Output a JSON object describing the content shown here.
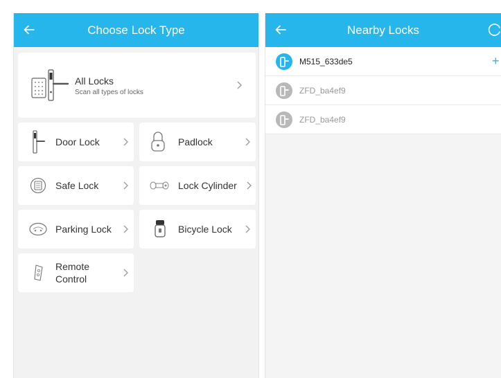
{
  "choose_lock_type": {
    "title": "Choose Lock Type",
    "all_locks": {
      "label": "All Locks",
      "subtitle": "Scan all types of locks"
    },
    "types": [
      {
        "label": "Door Lock",
        "icon": "door-lock-icon"
      },
      {
        "label": "Padlock",
        "icon": "padlock-icon"
      },
      {
        "label": "Safe Lock",
        "icon": "safe-lock-icon"
      },
      {
        "label": "Lock Cylinder",
        "icon": "lock-cylinder-icon"
      },
      {
        "label": "Parking Lock",
        "icon": "parking-lock-icon"
      },
      {
        "label": "Bicycle Lock",
        "icon": "bicycle-lock-icon"
      },
      {
        "label_line1": "Remote",
        "label_line2": "Control",
        "icon": "remote-control-icon"
      }
    ]
  },
  "nearby_locks": {
    "title": "Nearby Locks",
    "locks": [
      {
        "name": "M515_633de5",
        "status": "available",
        "action": "+"
      },
      {
        "name": "ZFD_ba4ef9",
        "status": "unavailable"
      },
      {
        "name": "ZFD_ba4ef9",
        "status": "unavailable"
      }
    ]
  },
  "colors": {
    "accent": "#27b6ec",
    "available_lock": "#27b6ec",
    "unavailable_lock": "#b8b8b8",
    "unavailable_text": "#9a9a9a"
  }
}
